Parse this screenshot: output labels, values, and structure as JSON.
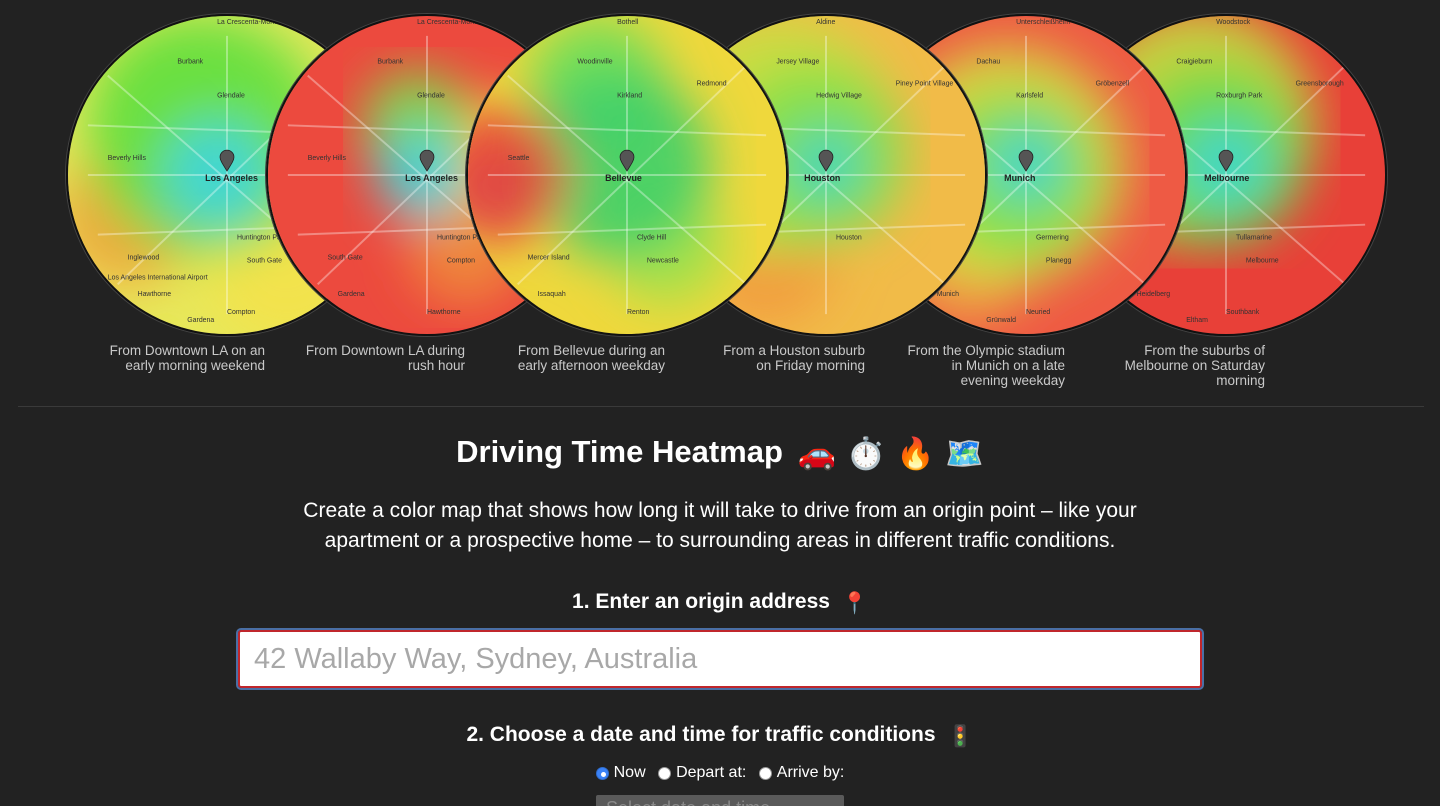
{
  "maps": [
    {
      "caption": "From Downtown LA on an early morning weekend",
      "city_label": "Los Angeles",
      "scheme": "la-morning",
      "labels": [
        "La Crescenta-Montrose",
        "Burbank",
        "Glendale",
        "Pasadena",
        "Beverly Hills",
        "Huntington Park",
        "Inglewood",
        "South Gate",
        "Compton",
        "Hawthorne",
        "Gardena",
        "Los Angeles International Airport"
      ]
    },
    {
      "caption": "From Downtown LA during rush hour",
      "city_label": "Los Angeles",
      "scheme": "la-rush",
      "labels": [
        "La Crescenta-Montrose",
        "Burbank",
        "Glendale",
        "Pasadena",
        "Beverly Hills",
        "Huntington Park",
        "South Gate",
        "Compton",
        "Hawthorne",
        "Gardena"
      ]
    },
    {
      "caption": "From Bellevue during an early afternoon weekday",
      "city_label": "Bellevue",
      "scheme": "bellevue",
      "labels": [
        "Bothell",
        "Woodinville",
        "Kirkland",
        "Redmond",
        "Seattle",
        "Clyde Hill",
        "Mercer Island",
        "Newcastle",
        "Renton",
        "Issaquah"
      ]
    },
    {
      "caption": "From a Houston suburb on Friday morning",
      "city_label": "Houston",
      "scheme": "houston",
      "labels": [
        "Aldine",
        "Jersey Village",
        "Hedwig Village",
        "Piney Point Village",
        "Bellaire",
        "Houston",
        "Pasadena"
      ]
    },
    {
      "caption": "From the Olympic stadium in Munich on a late evening weekday",
      "city_label": "Munich",
      "scheme": "munich",
      "labels": [
        "Unterschleißheim",
        "Dachau",
        "Karlsfeld",
        "Gröbenzell",
        "Puchheim",
        "Germering",
        "Gräfelfing",
        "Planegg",
        "Neuried",
        "Munich",
        "Grünwald"
      ]
    },
    {
      "caption": "From the suburbs of Melbourne on Saturday morning",
      "city_label": "Melbourne",
      "scheme": "melbourne",
      "labels": [
        "Woodstock",
        "Craigieburn",
        "Roxburgh Park",
        "Greensborough",
        "Doncaster",
        "Tullamarine",
        "Essendon",
        "Melbourne",
        "Southbank",
        "Heidelberg",
        "Eltham"
      ]
    }
  ],
  "heading": "Driving Time Heatmap",
  "heading_emoji": [
    "🚗",
    "⏱️",
    "🔥",
    "🗺️"
  ],
  "intro": "Create a color map that shows how long it will take to drive from an origin point – like your apartment or a prospective home – to surrounding areas in different traffic conditions.",
  "step1": {
    "label": "1. Enter an origin address",
    "emoji": "📍",
    "placeholder": "42 Wallaby Way, Sydney, Australia",
    "value": ""
  },
  "step2": {
    "label": "2. Choose a date and time for traffic conditions",
    "emoji": "🚦"
  },
  "time_options": [
    {
      "label": "Now",
      "selected": true
    },
    {
      "label": "Depart at:",
      "selected": false
    },
    {
      "label": "Arrive by:",
      "selected": false
    }
  ],
  "datetime_placeholder": "Select date and time",
  "colors": {
    "background": "#222222",
    "input_border": "#c0262c",
    "radio_selected": "#3b82f6"
  }
}
